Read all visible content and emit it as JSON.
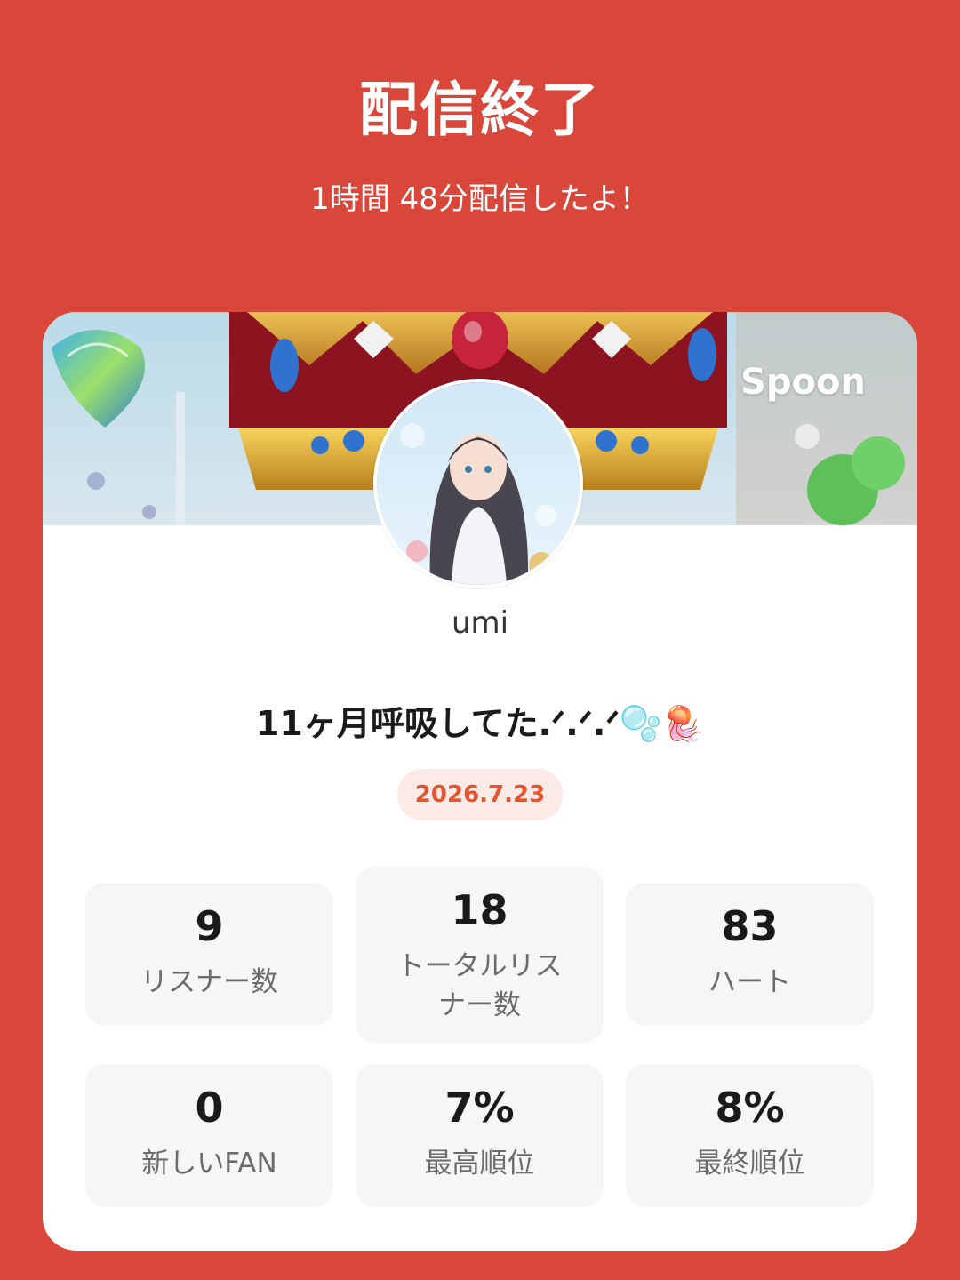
{
  "header": {
    "title": "配信終了",
    "subtitle": "1時間 48分配信したよ！"
  },
  "card": {
    "brand": "Spoon",
    "username": "umi",
    "live_title": "11ヶ月呼吸してた.ᐟ.ᐟ.ᐟ🫧🪼",
    "date": "2026.7.23"
  },
  "stats": [
    {
      "value": "9",
      "label": "リスナー数"
    },
    {
      "value": "18",
      "label": "トータルリスナー数"
    },
    {
      "value": "83",
      "label": "ハート"
    },
    {
      "value": "0",
      "label": "新しいFAN"
    },
    {
      "value": "7%",
      "label": "最高順位"
    },
    {
      "value": "8%",
      "label": "最終順位"
    }
  ],
  "colors": {
    "background": "#D8473A",
    "accent": "#E4552E",
    "date_badge_bg": "#FCEAE6",
    "stat_bg": "#F6F6F6"
  }
}
